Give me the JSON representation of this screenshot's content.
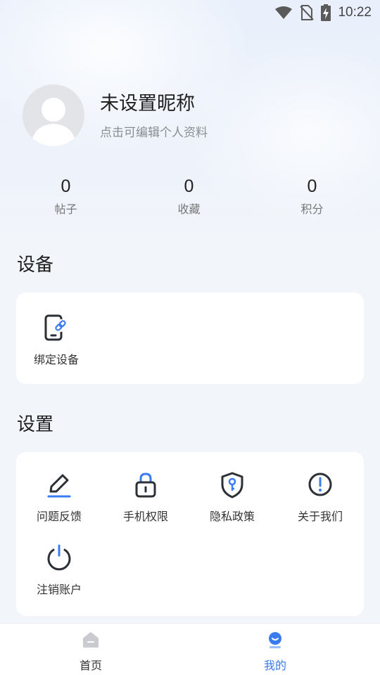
{
  "status_bar": {
    "time": "10:22"
  },
  "profile": {
    "nickname": "未设置昵称",
    "edit_hint": "点击可编辑个人资料"
  },
  "stats": [
    {
      "value": "0",
      "label": "帖子"
    },
    {
      "value": "0",
      "label": "收藏"
    },
    {
      "value": "0",
      "label": "积分"
    }
  ],
  "device_section": {
    "title": "设备",
    "items": [
      {
        "label": "绑定设备",
        "icon": "phone-link-icon"
      }
    ]
  },
  "settings_section": {
    "title": "设置",
    "items": [
      {
        "label": "问题反馈",
        "icon": "pencil-icon"
      },
      {
        "label": "手机权限",
        "icon": "lock-icon"
      },
      {
        "label": "隐私政策",
        "icon": "shield-key-icon"
      },
      {
        "label": "关于我们",
        "icon": "info-exclamation-icon"
      },
      {
        "label": "注销账户",
        "icon": "power-icon"
      }
    ]
  },
  "bottom_nav": {
    "items": [
      {
        "label": "首页",
        "icon": "home-icon",
        "active": false
      },
      {
        "label": "我的",
        "icon": "profile-icon",
        "active": true
      }
    ]
  },
  "colors": {
    "accent": "#3a7bf0",
    "icon_dark": "#2b2f36"
  }
}
